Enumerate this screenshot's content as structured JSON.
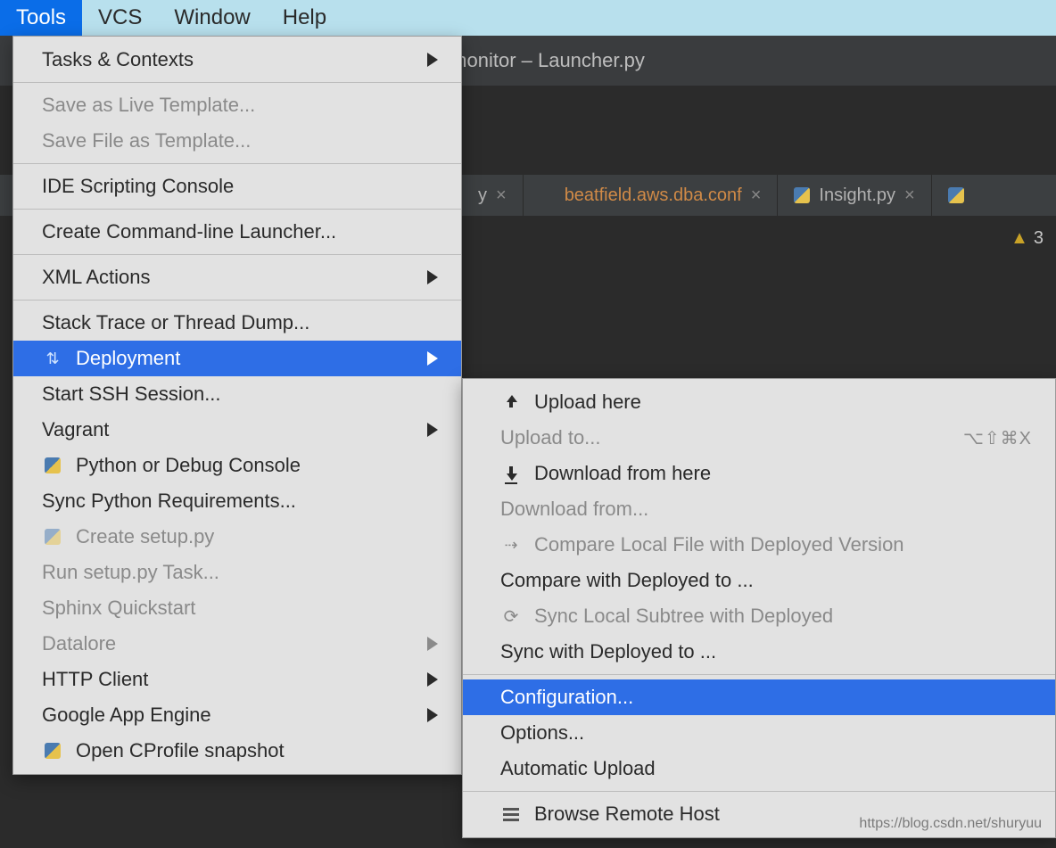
{
  "menubar": {
    "tools": "Tools",
    "vcs": "VCS",
    "window": "Window",
    "help": "Help"
  },
  "title": "prd_monitor – Launcher.py",
  "tabs": {
    "hidden_close": "×",
    "beatfield": "beatfield.aws.dba.conf",
    "insight": "Insight.py"
  },
  "status": {
    "warn_count": "3"
  },
  "tools_menu": {
    "tasks": "Tasks & Contexts",
    "save_live": "Save as Live Template...",
    "save_file": "Save File as Template...",
    "ide_scripting": "IDE Scripting Console",
    "cmd_launcher": "Create Command-line Launcher...",
    "xml": "XML Actions",
    "stack": "Stack Trace or Thread Dump...",
    "deployment": "Deployment",
    "ssh": "Start SSH Session...",
    "vagrant": "Vagrant",
    "py_console": "Python or Debug Console",
    "sync_req": "Sync Python Requirements...",
    "create_setup": "Create setup.py",
    "run_setup": "Run setup.py Task...",
    "sphinx": "Sphinx Quickstart",
    "datalore": "Datalore",
    "http": "HTTP Client",
    "gae": "Google App Engine",
    "cprofile": "Open CProfile snapshot"
  },
  "deploy_menu": {
    "upload_here": "Upload here",
    "upload_to": "Upload to...",
    "upload_to_shortcut": "⌥⇧⌘X",
    "download_here": "Download from here",
    "download_from": "Download from...",
    "compare_local": "Compare Local File with Deployed Version",
    "compare_with": "Compare with Deployed to ...",
    "sync_local": "Sync Local Subtree with Deployed",
    "sync_with": "Sync with Deployed to ...",
    "configuration": "Configuration...",
    "options": "Options...",
    "auto_upload": "Automatic Upload",
    "browse": "Browse Remote Host"
  },
  "watermark": "https://blog.csdn.net/shuryuu"
}
